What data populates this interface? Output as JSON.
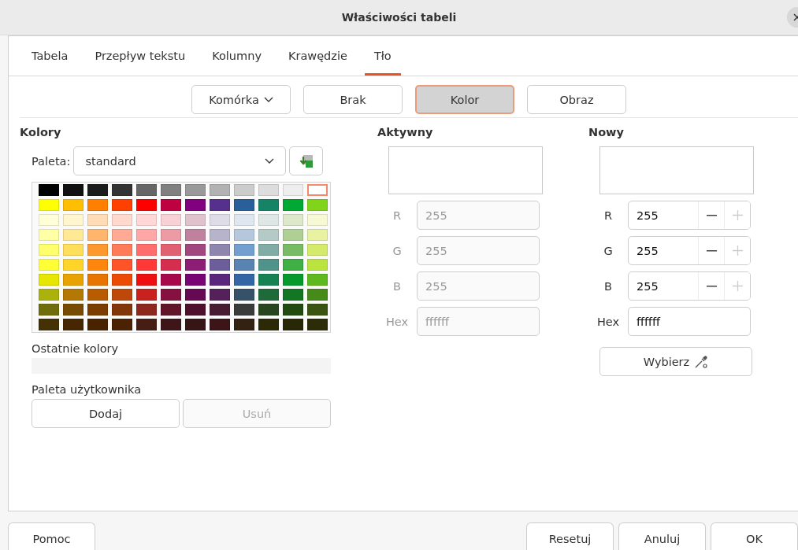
{
  "window": {
    "title": "Właściwości tabeli"
  },
  "tabs": [
    {
      "label": "Tabela",
      "selected": false
    },
    {
      "label": "Przepływ tekstu",
      "selected": false
    },
    {
      "label": "Kolumny",
      "selected": false
    },
    {
      "label": "Krawędzie",
      "selected": false
    },
    {
      "label": "Tło",
      "selected": true
    }
  ],
  "scope_dropdown": {
    "value": "Komórka"
  },
  "fill_types": [
    {
      "label": "Brak",
      "selected": false
    },
    {
      "label": "Kolor",
      "selected": true
    },
    {
      "label": "Obraz",
      "selected": false
    }
  ],
  "colors": {
    "heading": "Kolory",
    "palette_label": "Paleta:",
    "palette_value": "standard",
    "swatch_rows": [
      [
        {
          "color": "#000000",
          "selected": false
        },
        {
          "color": "#111111",
          "selected": false
        },
        {
          "color": "#1c1c1c",
          "selected": false
        },
        {
          "color": "#333333",
          "selected": false
        },
        {
          "color": "#666666",
          "selected": false
        },
        {
          "color": "#808080",
          "selected": false
        },
        {
          "color": "#999999",
          "selected": false
        },
        {
          "color": "#b2b2b2",
          "selected": false
        },
        {
          "color": "#cccccc",
          "selected": false
        },
        {
          "color": "#dddddd",
          "selected": false
        },
        {
          "color": "#eeeeee",
          "selected": false
        },
        {
          "color": "#ffffff",
          "selected": true
        }
      ],
      [
        {
          "color": "#ffff00",
          "selected": false
        },
        {
          "color": "#ffbf00",
          "selected": false
        },
        {
          "color": "#ff8000",
          "selected": false
        },
        {
          "color": "#ff4000",
          "selected": false
        },
        {
          "color": "#ff0000",
          "selected": false
        },
        {
          "color": "#bf0041",
          "selected": false
        },
        {
          "color": "#800080",
          "selected": false
        },
        {
          "color": "#55308d",
          "selected": false
        },
        {
          "color": "#2a6099",
          "selected": false
        },
        {
          "color": "#158466",
          "selected": false
        },
        {
          "color": "#00a933",
          "selected": false
        },
        {
          "color": "#81d41a",
          "selected": false
        }
      ],
      [
        {
          "color": "#ffffd7",
          "selected": false
        },
        {
          "color": "#fff5ce",
          "selected": false
        },
        {
          "color": "#ffdbb6",
          "selected": false
        },
        {
          "color": "#ffd8ce",
          "selected": false
        },
        {
          "color": "#ffd7d7",
          "selected": false
        },
        {
          "color": "#f7d1d5",
          "selected": false
        },
        {
          "color": "#e0c2cd",
          "selected": false
        },
        {
          "color": "#dedce6",
          "selected": false
        },
        {
          "color": "#dee6ef",
          "selected": false
        },
        {
          "color": "#dee7e5",
          "selected": false
        },
        {
          "color": "#dde8cb",
          "selected": false
        },
        {
          "color": "#f6f9d4",
          "selected": false
        }
      ],
      [
        {
          "color": "#ffffa6",
          "selected": false
        },
        {
          "color": "#ffe994",
          "selected": false
        },
        {
          "color": "#ffb66c",
          "selected": false
        },
        {
          "color": "#ffaa95",
          "selected": false
        },
        {
          "color": "#ffa6a6",
          "selected": false
        },
        {
          "color": "#ec9ba4",
          "selected": false
        },
        {
          "color": "#bf819e",
          "selected": false
        },
        {
          "color": "#b7b3ca",
          "selected": false
        },
        {
          "color": "#b4c7dc",
          "selected": false
        },
        {
          "color": "#b3cac7",
          "selected": false
        },
        {
          "color": "#afd095",
          "selected": false
        },
        {
          "color": "#e8f2a1",
          "selected": false
        }
      ],
      [
        {
          "color": "#ffff6d",
          "selected": false
        },
        {
          "color": "#ffde59",
          "selected": false
        },
        {
          "color": "#ff972f",
          "selected": false
        },
        {
          "color": "#ff7b59",
          "selected": false
        },
        {
          "color": "#ff6d6d",
          "selected": false
        },
        {
          "color": "#e16173",
          "selected": false
        },
        {
          "color": "#a1467e",
          "selected": false
        },
        {
          "color": "#8e86ae",
          "selected": false
        },
        {
          "color": "#729fcf",
          "selected": false
        },
        {
          "color": "#81aca6",
          "selected": false
        },
        {
          "color": "#77bc65",
          "selected": false
        },
        {
          "color": "#d4ea6b",
          "selected": false
        }
      ],
      [
        {
          "color": "#ffff38",
          "selected": false
        },
        {
          "color": "#ffd428",
          "selected": false
        },
        {
          "color": "#ff860d",
          "selected": false
        },
        {
          "color": "#ff5429",
          "selected": false
        },
        {
          "color": "#ff3838",
          "selected": false
        },
        {
          "color": "#d62e4e",
          "selected": false
        },
        {
          "color": "#8d1d75",
          "selected": false
        },
        {
          "color": "#6b5e9b",
          "selected": false
        },
        {
          "color": "#5983b0",
          "selected": false
        },
        {
          "color": "#50938a",
          "selected": false
        },
        {
          "color": "#3faf46",
          "selected": false
        },
        {
          "color": "#bbe33d",
          "selected": false
        }
      ],
      [
        {
          "color": "#e6e600",
          "selected": false
        },
        {
          "color": "#e8a202",
          "selected": false
        },
        {
          "color": "#e87402",
          "selected": false
        },
        {
          "color": "#ec4b06",
          "selected": false
        },
        {
          "color": "#ee1010",
          "selected": false
        },
        {
          "color": "#a7074b",
          "selected": false
        },
        {
          "color": "#780373",
          "selected": false
        },
        {
          "color": "#5b277d",
          "selected": false
        },
        {
          "color": "#3465a4",
          "selected": false
        },
        {
          "color": "#168253",
          "selected": false
        },
        {
          "color": "#069a2e",
          "selected": false
        },
        {
          "color": "#5eb91e",
          "selected": false
        }
      ],
      [
        {
          "color": "#acb20c",
          "selected": false
        },
        {
          "color": "#b47804",
          "selected": false
        },
        {
          "color": "#b85c00",
          "selected": false
        },
        {
          "color": "#be480a",
          "selected": false
        },
        {
          "color": "#c9211e",
          "selected": false
        },
        {
          "color": "#861141",
          "selected": false
        },
        {
          "color": "#650953",
          "selected": false
        },
        {
          "color": "#55215b",
          "selected": false
        },
        {
          "color": "#355269",
          "selected": false
        },
        {
          "color": "#1e6a39",
          "selected": false
        },
        {
          "color": "#127622",
          "selected": false
        },
        {
          "color": "#468a1a",
          "selected": false
        }
      ],
      [
        {
          "color": "#706e0c",
          "selected": false
        },
        {
          "color": "#784b04",
          "selected": false
        },
        {
          "color": "#7b3d00",
          "selected": false
        },
        {
          "color": "#813709",
          "selected": false
        },
        {
          "color": "#8d281e",
          "selected": false
        },
        {
          "color": "#611729",
          "selected": false
        },
        {
          "color": "#4e102d",
          "selected": false
        },
        {
          "color": "#481d32",
          "selected": false
        },
        {
          "color": "#383d3c",
          "selected": false
        },
        {
          "color": "#28471f",
          "selected": false
        },
        {
          "color": "#224b12",
          "selected": false
        },
        {
          "color": "#395511",
          "selected": false
        }
      ],
      [
        {
          "color": "#443205",
          "selected": false
        },
        {
          "color": "#472702",
          "selected": false
        },
        {
          "color": "#492300",
          "selected": false
        },
        {
          "color": "#4b2204",
          "selected": false
        },
        {
          "color": "#471e14",
          "selected": false
        },
        {
          "color": "#3e1619",
          "selected": false
        },
        {
          "color": "#371514",
          "selected": false
        },
        {
          "color": "#3b1518",
          "selected": false
        },
        {
          "color": "#332211",
          "selected": false
        },
        {
          "color": "#2c2907",
          "selected": false
        },
        {
          "color": "#282806",
          "selected": false
        },
        {
          "color": "#2d2c08",
          "selected": false
        }
      ]
    ],
    "recent_label": "Ostatnie kolory",
    "custom_label": "Paleta użytkownika",
    "custom_buttons": [
      {
        "label": "Dodaj",
        "disabled": false
      },
      {
        "label": "Usuń",
        "disabled": true
      }
    ]
  },
  "active": {
    "heading": "Aktywny",
    "disabled": true,
    "fields": [
      {
        "label": "R",
        "value": "255"
      },
      {
        "label": "G",
        "value": "255"
      },
      {
        "label": "B",
        "value": "255"
      },
      {
        "label": "Hex",
        "value": "ffffff"
      }
    ]
  },
  "new": {
    "heading": "Nowy",
    "fields": [
      {
        "label": "R",
        "value": "255",
        "kind": "spin",
        "increment_disabled": true
      },
      {
        "label": "G",
        "value": "255",
        "kind": "spin",
        "increment_disabled": true
      },
      {
        "label": "B",
        "value": "255",
        "kind": "spin",
        "increment_disabled": true
      },
      {
        "label": "Hex",
        "value": "ffffff",
        "kind": "text"
      }
    ],
    "pick_button": "Wybierz"
  },
  "footer": {
    "help": "Pomoc",
    "buttons": [
      "Resetuj",
      "Anuluj",
      "OK"
    ]
  }
}
